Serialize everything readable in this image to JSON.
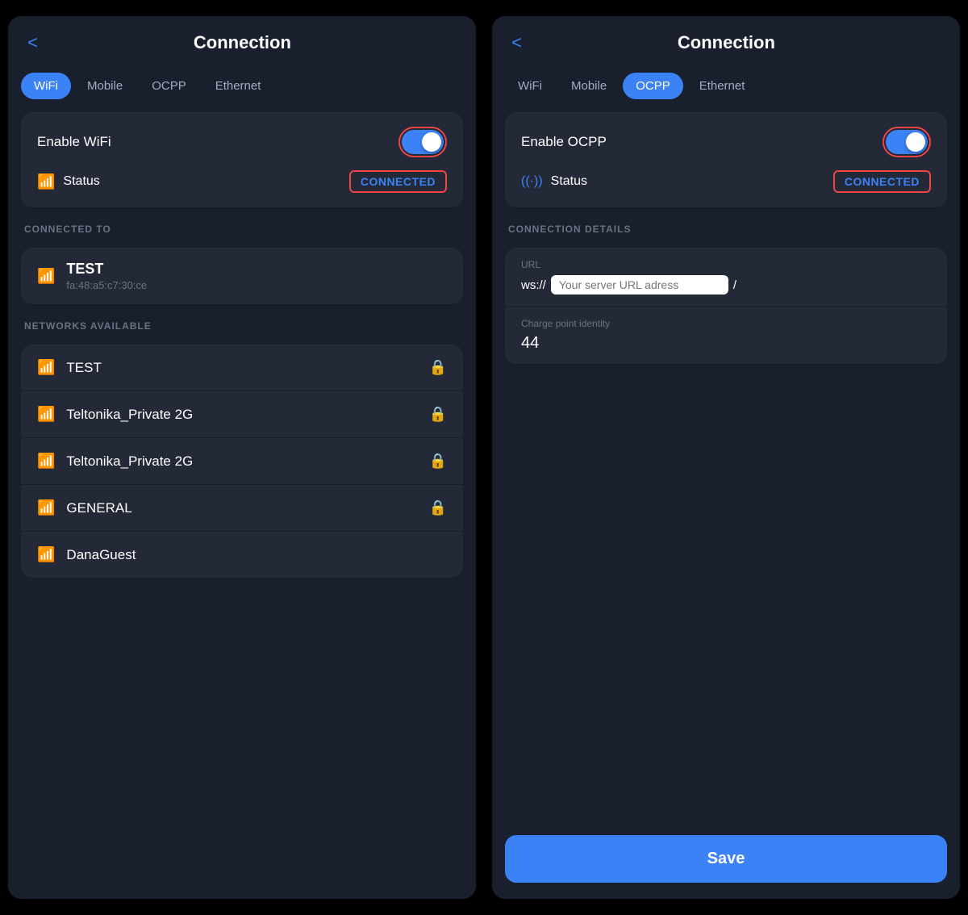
{
  "left_panel": {
    "title": "Connection",
    "back_label": "<",
    "tabs": [
      {
        "id": "wifi",
        "label": "WiFi",
        "active": true
      },
      {
        "id": "mobile",
        "label": "Mobile",
        "active": false
      },
      {
        "id": "ocpp",
        "label": "OCPP",
        "active": false
      },
      {
        "id": "ethernet",
        "label": "Ethernet",
        "active": false
      }
    ],
    "enable_label": "Enable WiFi",
    "toggle_on": true,
    "status_label": "Status",
    "status_value": "CONNECTED",
    "connected_to_title": "CONNECTED TO",
    "connected_network": {
      "name": "TEST",
      "mac": "fa:48:a5:c7:30:ce"
    },
    "networks_available_title": "NETWORKS AVAILABLE",
    "networks": [
      {
        "name": "TEST",
        "locked": true
      },
      {
        "name": "Teltonika_Private 2G",
        "locked": true
      },
      {
        "name": "Teltonika_Private 2G",
        "locked": true
      },
      {
        "name": "GENERAL",
        "locked": true
      },
      {
        "name": "DanaGuest",
        "locked": false
      }
    ]
  },
  "right_panel": {
    "title": "Connection",
    "back_label": "<",
    "tabs": [
      {
        "id": "wifi",
        "label": "WiFi",
        "active": false
      },
      {
        "id": "mobile",
        "label": "Mobile",
        "active": false
      },
      {
        "id": "ocpp",
        "label": "OCPP",
        "active": true
      },
      {
        "id": "ethernet",
        "label": "Ethernet",
        "active": false
      }
    ],
    "enable_label": "Enable OCPP",
    "toggle_on": true,
    "status_label": "Status",
    "status_value": "CONNECTED",
    "connection_details_title": "CONNECTION DETAILS",
    "url_label": "URL",
    "url_prefix": "ws://",
    "url_placeholder": "Your server URL adress",
    "url_suffix": "/",
    "charge_point_label": "Charge point identity",
    "charge_point_value": "44",
    "save_label": "Save"
  },
  "icons": {
    "wifi": "📶",
    "lock": "🔒",
    "signal": "((·))"
  }
}
